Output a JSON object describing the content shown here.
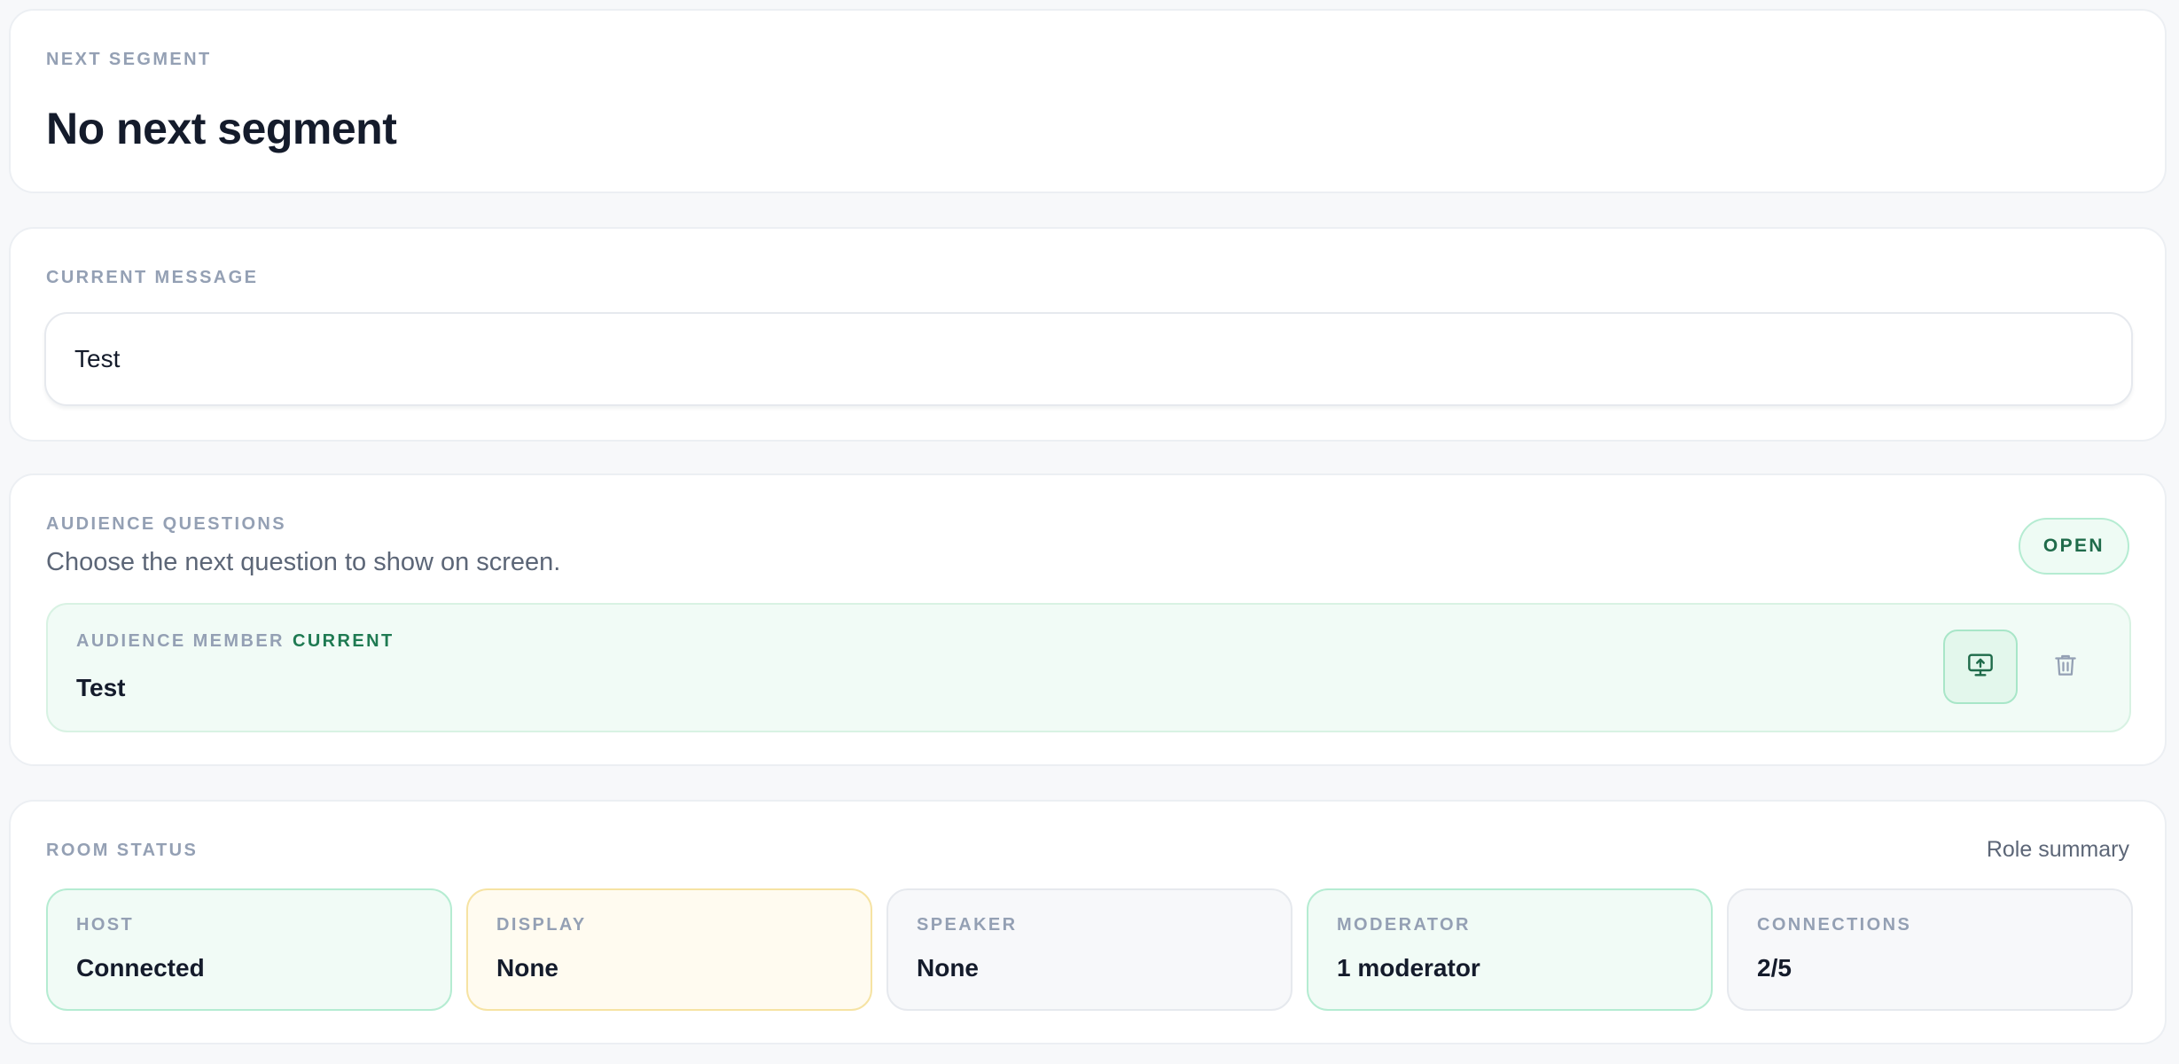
{
  "next_segment": {
    "label": "NEXT SEGMENT",
    "title": "No next segment"
  },
  "current_message": {
    "label": "CURRENT MESSAGE",
    "value": "Test"
  },
  "audience_questions": {
    "label": "AUDIENCE QUESTIONS",
    "subtitle": "Choose the next question to show on screen.",
    "status_badge": "OPEN",
    "items": [
      {
        "author": "AUDIENCE MEMBER",
        "tag": "CURRENT",
        "text": "Test",
        "show_icon": "monitor-upload-icon",
        "delete_icon": "trash-icon"
      }
    ]
  },
  "room_status": {
    "label": "ROOM STATUS",
    "summary_link": "Role summary",
    "tiles": [
      {
        "label": "HOST",
        "value": "Connected",
        "state": "green"
      },
      {
        "label": "DISPLAY",
        "value": "None",
        "state": "yellow"
      },
      {
        "label": "SPEAKER",
        "value": "None",
        "state": "gray"
      },
      {
        "label": "MODERATOR",
        "value": "1 moderator",
        "state": "green"
      },
      {
        "label": "CONNECTIONS",
        "value": "2/5",
        "state": "gray"
      }
    ]
  },
  "colors": {
    "accent_green": "#1f7a52",
    "badge_green_bg": "#eefbf4",
    "muted_label": "#94a0b4",
    "warning_yellow_border": "#f6e3a3"
  }
}
